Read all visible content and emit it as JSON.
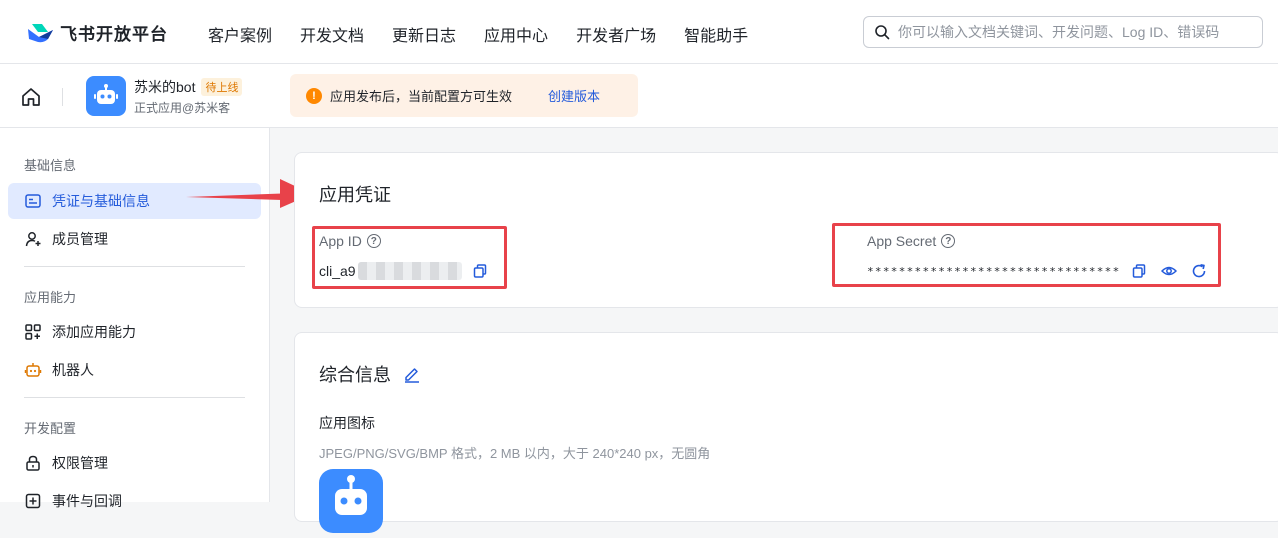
{
  "brand": {
    "name": "飞书开放平台"
  },
  "nav": [
    "客户案例",
    "开发文档",
    "更新日志",
    "应用中心",
    "开发者广场",
    "智能助手"
  ],
  "search": {
    "placeholder": "你可以输入文档关键词、开发问题、Log ID、错误码"
  },
  "app": {
    "name": "苏米的bot",
    "status_badge": "待上线",
    "subtitle": "正式应用@苏米客"
  },
  "notice": {
    "text": "应用发布后，当前配置方可生效",
    "link": "创建版本"
  },
  "sidebar": {
    "groups": [
      "基础信息",
      "应用能力",
      "开发配置"
    ],
    "items": [
      "凭证与基础信息",
      "成员管理",
      "添加应用能力",
      "机器人",
      "权限管理",
      "事件与回调"
    ]
  },
  "credentials": {
    "title": "应用凭证",
    "app_id_label": "App ID",
    "app_id_value": "cli_a9",
    "app_secret_label": "App Secret",
    "app_secret_value": "********************************"
  },
  "general": {
    "title": "综合信息",
    "icon_label": "应用图标",
    "icon_hint": "JPEG/PNG/SVG/BMP 格式，2 MB 以内，大于 240*240 px，无圆角"
  },
  "colors": {
    "accent": "#245bdb",
    "annotation_red": "#e8424a",
    "warning": "#ff8800"
  }
}
